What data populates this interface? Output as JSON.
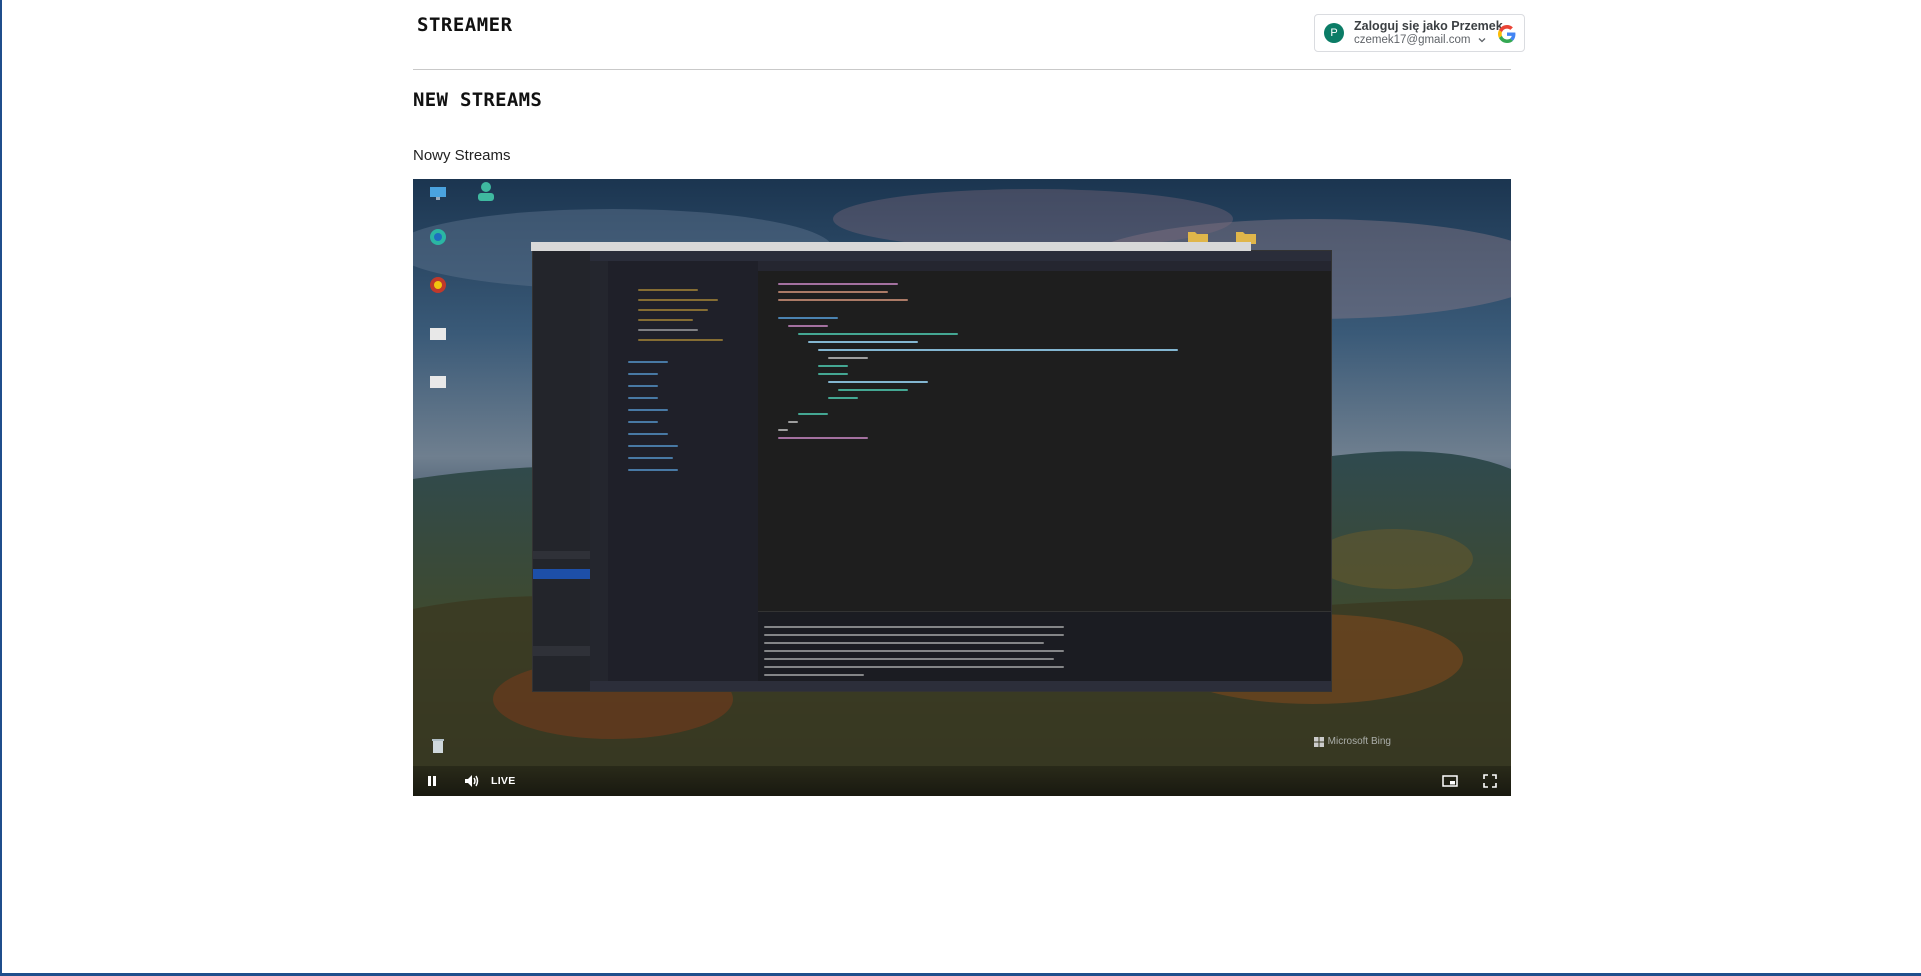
{
  "app": {
    "brand": "STREAMER",
    "section_title": "NEW STREAMS"
  },
  "account": {
    "avatar_letter": "P",
    "signin_label": "Zaloguj się jako Przemek",
    "email": "czemek17@gmail.com",
    "icons": [
      "chevron-down-icon",
      "google-logo-icon"
    ]
  },
  "stream": {
    "name": "Nowy Streams",
    "live_label": "LIVE",
    "controls": [
      "pause-icon",
      "volume-icon",
      "picture-in-picture-icon",
      "fullscreen-icon"
    ],
    "watermark": "Microsoft Bing"
  },
  "colors": {
    "frame": "#1f4e8c",
    "avatar": "#0b7c66",
    "text": "#111111"
  }
}
